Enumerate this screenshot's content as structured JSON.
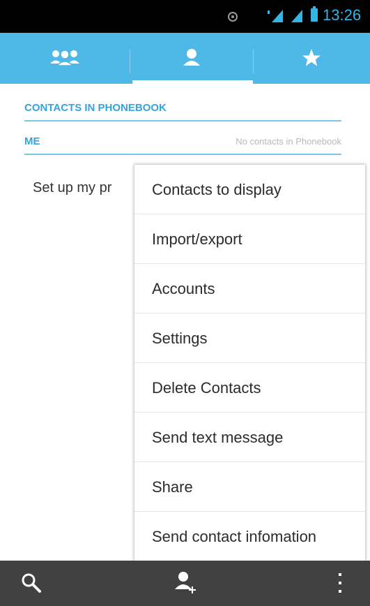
{
  "status_bar": {
    "time": "13:26",
    "icons": [
      "record-icon",
      "signal-icon",
      "signal-icon",
      "battery-icon"
    ],
    "accent_color": "#33b5e5"
  },
  "tabs": [
    {
      "name": "groups",
      "icon": "groups-icon",
      "selected": false
    },
    {
      "name": "contacts",
      "icon": "person-icon",
      "selected": true
    },
    {
      "name": "favorites",
      "icon": "star-icon",
      "selected": false
    }
  ],
  "tab_bar_color": "#4eb8e6",
  "content": {
    "contacts_header": "CONTACTS IN PHONEBOOK",
    "me_header": "ME",
    "me_status": "No contacts in Phonebook",
    "setup_profile": "Set up my pr"
  },
  "menu": {
    "items": [
      "Contacts to display",
      "Import/export",
      "Accounts",
      "Settings",
      "Delete Contacts",
      "Send text message",
      "Share",
      "Send contact infomation"
    ]
  },
  "bottom_bar": {
    "icons": [
      "search-icon",
      "add-contact-icon",
      "overflow-menu-icon"
    ]
  }
}
